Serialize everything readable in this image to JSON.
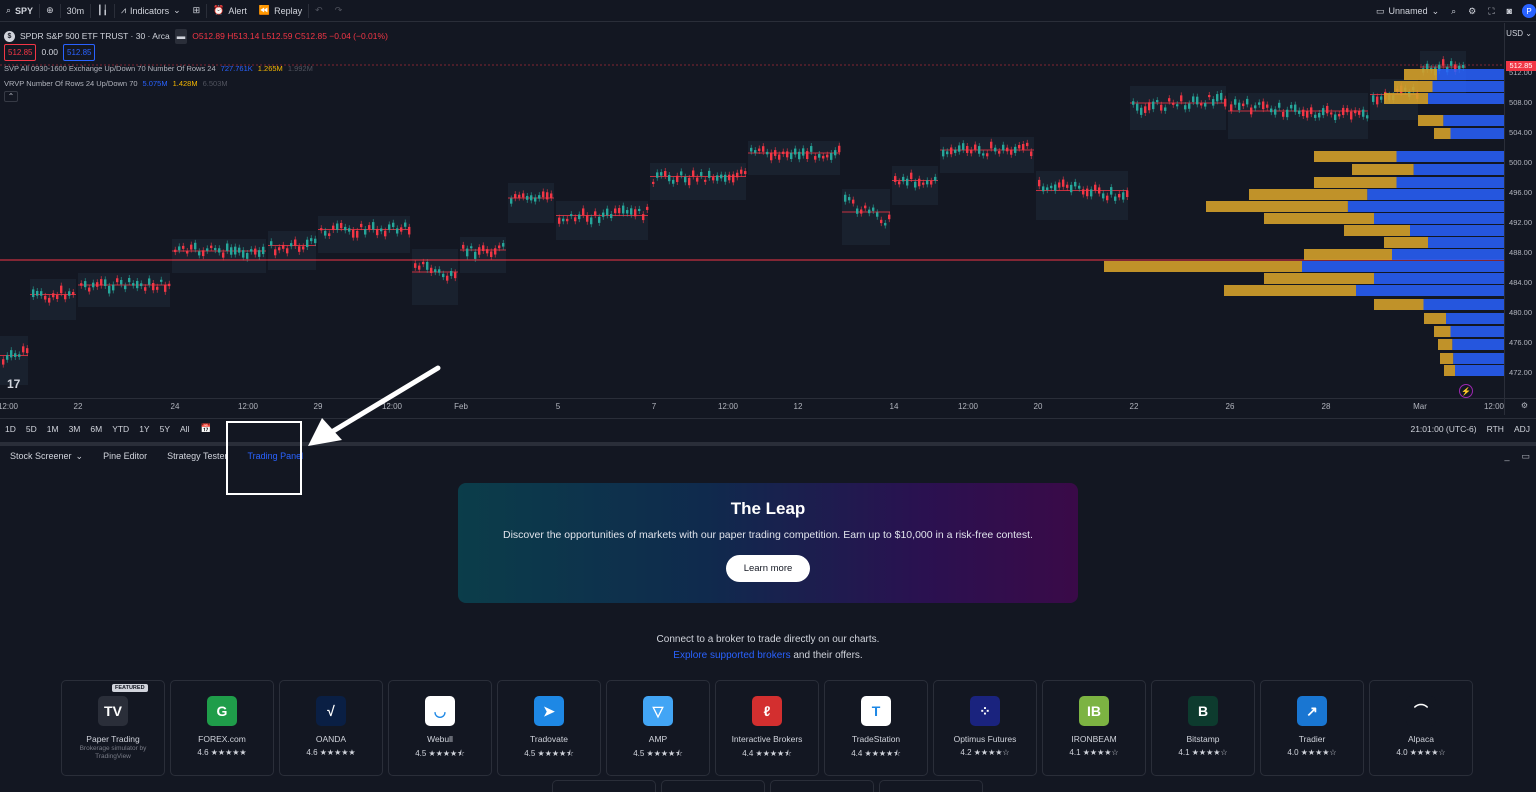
{
  "topbar": {
    "symbol": "SPY",
    "interval": "30m",
    "indicators_label": "Indicators",
    "alert_label": "Alert",
    "replay_label": "Replay",
    "layout_name": "Unnamed"
  },
  "legend": {
    "symbol_title": "SPDR S&P 500 ETF TRUST · 30 · Arca",
    "ohlc": "O512.89 H513.14 L512.59 C512.85 −0.04 (−0.01%)",
    "bid": "512.85",
    "spread": "0.00",
    "ask": "512.85",
    "svp_label": "SVP All 0930-1600 Exchange Up/Down 70 Number Of Rows 24",
    "svp_v1": "727.761K",
    "svp_v2": "1.265M",
    "svp_v3": "1.992M",
    "vrvp_label": "VRVP Number Of Rows 24 Up/Down 70",
    "vrvp_v1": "5.075M",
    "vrvp_v2": "1.428M",
    "vrvp_v3": "6.503M"
  },
  "price_axis": {
    "currency": "USD",
    "current_price": "512.85",
    "labels": [
      "512.00",
      "508.00",
      "504.00",
      "500.00",
      "496.00",
      "492.00",
      "488.00",
      "484.00",
      "480.00",
      "476.00",
      "472.00"
    ]
  },
  "time_axis": [
    "12:00",
    "22",
    "24",
    "12:00",
    "29",
    "12:00",
    "Feb",
    "5",
    "7",
    "12:00",
    "12",
    "14",
    "12:00",
    "20",
    "22",
    "26",
    "28",
    "Mar",
    "12:00"
  ],
  "range_bar": {
    "ranges": [
      "1D",
      "5D",
      "1M",
      "3M",
      "6M",
      "YTD",
      "1Y",
      "5Y",
      "All"
    ],
    "clock": "21:01:00 (UTC-6)",
    "session": "RTH",
    "adj": "ADJ"
  },
  "tabs": [
    "Stock Screener",
    "Pine Editor",
    "Strategy Tester",
    "Trading Panel"
  ],
  "banner": {
    "title": "The Leap",
    "text": "Discover the opportunities of markets with our paper trading competition. Earn up to $10,000 in a risk-free contest.",
    "button": "Learn more"
  },
  "connect": {
    "line1": "Connect to a broker to trade directly on our charts.",
    "link": "Explore supported brokers",
    "line2_rest": " and their offers."
  },
  "featured_label": "FEATURED",
  "brokers": [
    {
      "name": "Paper Trading",
      "sub": "Brokerage simulator by TradingView",
      "rating": "",
      "color": "#2a2e39",
      "glyph": "TV"
    },
    {
      "name": "FOREX.com",
      "rating": "4.6 ★★★★★",
      "color": "#1f9d4a",
      "glyph": "G"
    },
    {
      "name": "OANDA",
      "rating": "4.6 ★★★★★",
      "color": "#0a1f44",
      "glyph": "√"
    },
    {
      "name": "Webull",
      "rating": "4.5 ★★★★⯪",
      "color": "#ffffff",
      "glyph": "◡"
    },
    {
      "name": "Tradovate",
      "rating": "4.5 ★★★★⯪",
      "color": "#1e88e5",
      "glyph": "➤"
    },
    {
      "name": "AMP",
      "rating": "4.5 ★★★★⯪",
      "color": "#42a5f5",
      "glyph": "▽"
    },
    {
      "name": "Interactive Brokers",
      "rating": "4.4 ★★★★⯪",
      "color": "#d32f2f",
      "glyph": "ℓ"
    },
    {
      "name": "TradeStation",
      "rating": "4.4 ★★★★⯪",
      "color": "#ffffff",
      "glyph": "T"
    },
    {
      "name": "Optimus Futures",
      "rating": "4.2 ★★★★☆",
      "color": "#1a237e",
      "glyph": "⁘"
    },
    {
      "name": "IRONBEAM",
      "rating": "4.1 ★★★★☆",
      "color": "#7cb342",
      "glyph": "IB"
    },
    {
      "name": "Bitstamp",
      "rating": "4.1 ★★★★☆",
      "color": "#0d3b2e",
      "glyph": "B"
    },
    {
      "name": "Tradier",
      "rating": "4.0 ★★★★☆",
      "color": "#1976d2",
      "glyph": "↗"
    },
    {
      "name": "Alpaca",
      "rating": "4.0 ★★★★☆",
      "color": "#131722",
      "glyph": "⌒"
    }
  ],
  "colors": {
    "up": "#26a69a",
    "down": "#f23645",
    "accent": "#2962ff",
    "profile_up": "#2962ff",
    "profile_down": "#d4a02a"
  }
}
